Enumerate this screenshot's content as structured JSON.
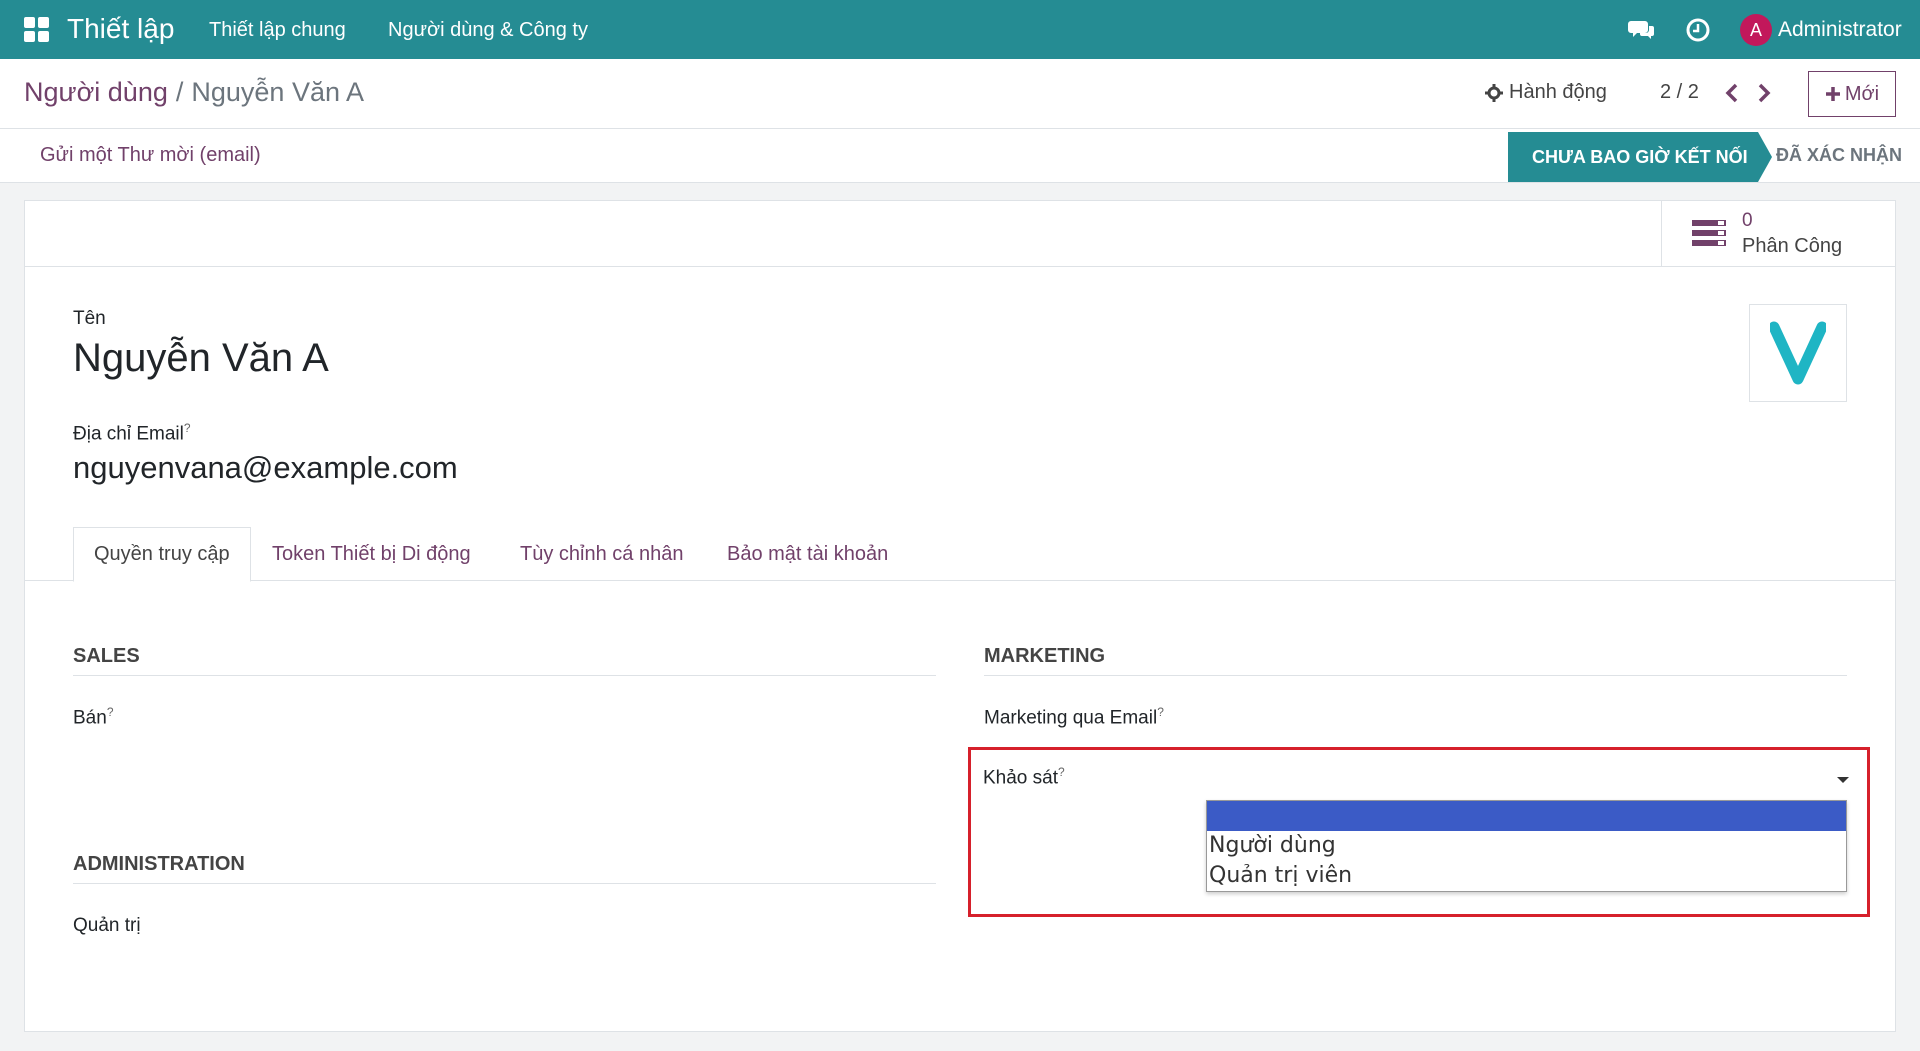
{
  "navbar": {
    "app_title": "Thiết lập",
    "menu": [
      "Thiết lập chung",
      "Người dùng & Công ty"
    ],
    "user_initial": "A",
    "user_name": "Administrator",
    "icons": [
      "apps-grid-icon",
      "chat-icon",
      "clock-icon"
    ]
  },
  "breadcrumb": {
    "parent": "Người dùng",
    "separator": "/",
    "current": "Nguyễn Văn A"
  },
  "control": {
    "action_label": "Hành động",
    "pager": "2 / 2",
    "new_label": "Mới"
  },
  "status": {
    "invite_label": "Gửi một Thư mời (email)",
    "stages": [
      "CHƯA BAO GIỜ KẾT NỐI",
      "ĐÃ XÁC NHẬN"
    ],
    "active_stage": "CHƯA BAO GIỜ KẾT NỐI"
  },
  "stat_button": {
    "value": "0",
    "label": "Phân Công"
  },
  "form": {
    "name_label": "Tên",
    "name_value": "Nguyễn Văn A",
    "email_label": "Địa chỉ Email",
    "email_value": "nguyenvana@example.com",
    "help_mark": "?",
    "logo_letter": "V"
  },
  "tabs": [
    "Quyền truy cập",
    "Token Thiết bị Di động",
    "Tùy chỉnh cá nhân",
    "Bảo mật tài khoản"
  ],
  "sections": {
    "sales": {
      "title": "SALES",
      "field": "Bán"
    },
    "administration": {
      "title": "ADMINISTRATION",
      "field": "Quản trị"
    },
    "marketing": {
      "title": "MARKETING",
      "field_email": "Marketing qua Email",
      "field_survey": "Khảo sát"
    }
  },
  "survey_dropdown": {
    "options": [
      "",
      "Người dùng",
      "Quản trị viên"
    ],
    "highlighted_index": 0
  },
  "colors": {
    "navbar": "#258c93",
    "brand_purple": "#71416a",
    "highlight_border": "#d6202b",
    "selected_option": "#3b5bc6"
  }
}
